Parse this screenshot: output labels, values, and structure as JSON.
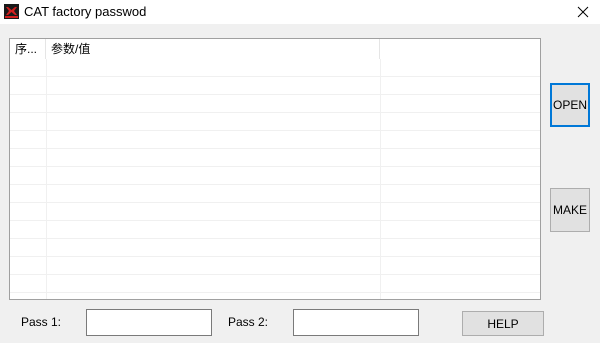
{
  "window": {
    "title": "CAT factory passwod",
    "icon": "cat-logo-icon",
    "close_icon": "close-icon"
  },
  "table": {
    "columns": [
      "序...",
      "参数/值",
      ""
    ],
    "rows": []
  },
  "buttons": {
    "open_label": "OPEN",
    "make_label": "MAKE",
    "help_label": "HELP"
  },
  "fields": {
    "pass1_label": "Pass 1:",
    "pass1_value": "",
    "pass2_label": "Pass 2:",
    "pass2_value": ""
  },
  "colors": {
    "focus_border": "#0078d7",
    "window_bg": "#f0f0f0",
    "button_bg": "#e1e1e1"
  }
}
